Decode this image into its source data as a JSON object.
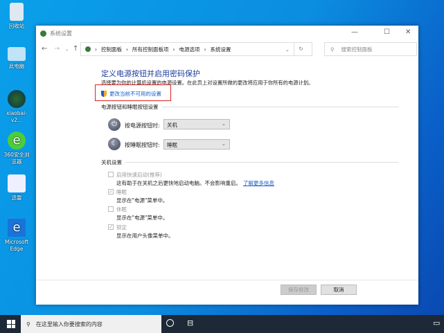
{
  "desktop": {
    "icons": [
      {
        "label": "回收站"
      },
      {
        "label": "此电脑"
      },
      {
        "label": "xiaobai-v2..."
      },
      {
        "label": "360安全浏览器"
      },
      {
        "label": "迅雷"
      },
      {
        "label": "Microsoft Edge"
      }
    ]
  },
  "window": {
    "title": "系统设置",
    "breadcrumb": [
      "控制面板",
      "所有控制面板项",
      "电源选项",
      "系统设置"
    ],
    "search_placeholder": "搜索控制面板",
    "heading": "定义电源按钮并启用密码保护",
    "description": "选择要为你的计算机设置的电源设置。在此页上对设置所做的更改将应用于你所有的电源计划。",
    "change_link": "更改当前不可用的设置",
    "section_buttons": "电源按钮和睡眠按钮设置",
    "power_label": "按电源按钮时:",
    "power_value": "关机",
    "sleep_label": "按睡眠按钮时:",
    "sleep_value": "睡眠",
    "section_shutdown": "关机设置",
    "options": [
      {
        "label": "启用快速启动(推荐)",
        "checked": false,
        "desc": "这有助于在关机之后更快地启动电脑。不会影响重启。",
        "link": "了解更多信息"
      },
      {
        "label": "睡眠",
        "checked": true,
        "desc": "显示在\"电源\"菜单中。"
      },
      {
        "label": "休眠",
        "checked": false,
        "desc": "显示在\"电源\"菜单中。"
      },
      {
        "label": "锁定",
        "checked": true,
        "desc": "显示在用户头像菜单中。"
      }
    ],
    "save": "保存修改",
    "cancel": "取消"
  },
  "taskbar": {
    "search_placeholder": "在这里输入你要搜索的内容"
  }
}
